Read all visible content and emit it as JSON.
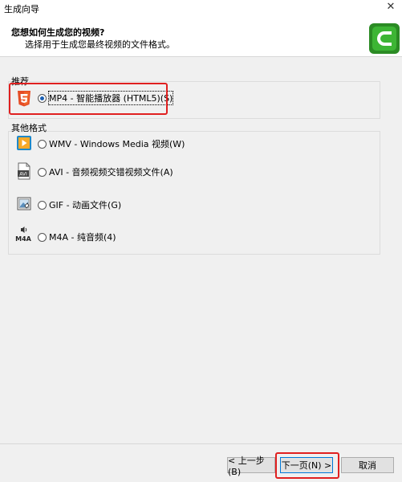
{
  "window": {
    "title": "生成向导",
    "close_glyph": "✕"
  },
  "header": {
    "title": "您想如何生成您的视频?",
    "subtitle": "选择用于生成您最终视频的文件格式。"
  },
  "recommended": {
    "label": "推荐",
    "option": {
      "label": "MP4 - 智能播放器 (HTML5)(S)",
      "selected": true,
      "icon": "html5-icon"
    }
  },
  "other_formats": {
    "label": "其他格式",
    "options": [
      {
        "label": "WMV - Windows Media 视频(W)",
        "selected": false,
        "icon": "wmv-video-icon"
      },
      {
        "label": "AVI - 音频视频交错视频文件(A)",
        "selected": false,
        "icon": "avi-file-icon"
      },
      {
        "label": "GIF - 动画文件(G)",
        "selected": false,
        "icon": "gif-file-icon"
      },
      {
        "label": "M4A - 纯音频(4)",
        "selected": false,
        "icon": "m4a-audio-icon"
      }
    ]
  },
  "icon_text": {
    "avi": "AVI",
    "m4a": "M4A"
  },
  "buttons": {
    "back": "< 上一步(B)",
    "next": "下一页(N) >",
    "cancel": "取消"
  },
  "colors": {
    "highlight": "#e02020",
    "html5": "#e44d26",
    "logo": "#3db534"
  }
}
